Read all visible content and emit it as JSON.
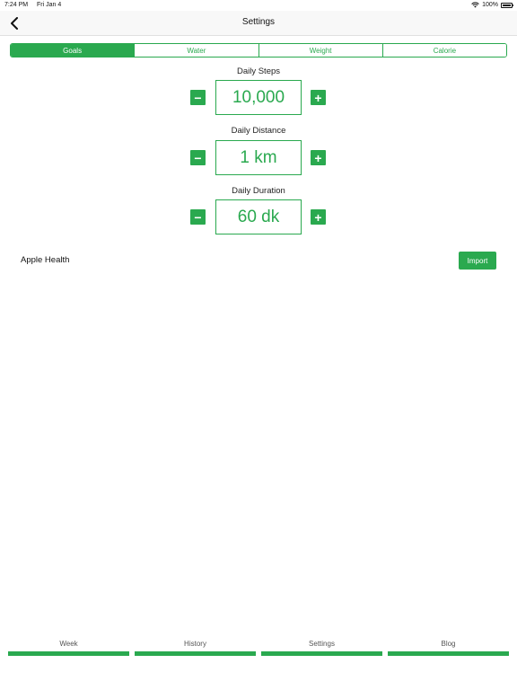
{
  "status_bar": {
    "time": "7:24 PM",
    "date": "Fri Jan 4",
    "battery": "100%"
  },
  "nav": {
    "title": "Settings"
  },
  "segments": [
    {
      "label": "Goals",
      "active": true
    },
    {
      "label": "Water",
      "active": false
    },
    {
      "label": "Weight",
      "active": false
    },
    {
      "label": "Calorie",
      "active": false
    }
  ],
  "goals": {
    "steps": {
      "label": "Daily Steps",
      "value": "10,000",
      "minus": "−",
      "plus": "+"
    },
    "distance": {
      "label": "Daily Distance",
      "value": "1 km",
      "minus": "−",
      "plus": "+"
    },
    "duration": {
      "label": "Daily Duration",
      "value": "60 dk",
      "minus": "−",
      "plus": "+"
    }
  },
  "health": {
    "label": "Apple Health",
    "import_label": "Import"
  },
  "tabs": [
    {
      "label": "Week"
    },
    {
      "label": "History"
    },
    {
      "label": "Settings"
    },
    {
      "label": "Blog"
    }
  ],
  "colors": {
    "accent": "#2aa94f",
    "nav_bg": "#f8f8f8"
  }
}
